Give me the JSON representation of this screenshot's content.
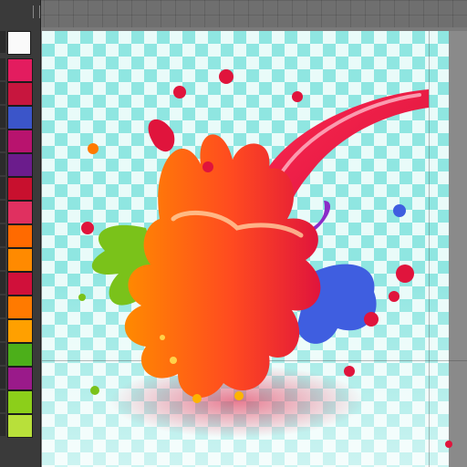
{
  "palette": {
    "swatches": [
      {
        "name": "white",
        "color": "#fafafa"
      },
      {
        "name": "pink",
        "color": "#e31c5f"
      },
      {
        "name": "crimson",
        "color": "#c7163e"
      },
      {
        "name": "blue",
        "color": "#3b55c9"
      },
      {
        "name": "magenta",
        "color": "#b8136e"
      },
      {
        "name": "purple",
        "color": "#6b1c8c"
      },
      {
        "name": "red",
        "color": "#c8102e"
      },
      {
        "name": "rose",
        "color": "#e03060"
      },
      {
        "name": "orange",
        "color": "#ff6a00"
      },
      {
        "name": "amber",
        "color": "#ff8a00"
      },
      {
        "name": "deep-red",
        "color": "#d0103a"
      },
      {
        "name": "orange-2",
        "color": "#ff7a00"
      },
      {
        "name": "yellow-orange",
        "color": "#ffa000"
      },
      {
        "name": "green",
        "color": "#4caf1a"
      },
      {
        "name": "violet",
        "color": "#9a1a8a"
      },
      {
        "name": "lime",
        "color": "#8ccf1a"
      },
      {
        "name": "light-lime",
        "color": "#b8e03a"
      }
    ]
  },
  "artwork": {
    "subject": "paint-splash",
    "colors": {
      "stream_red": "#e0143c",
      "splash_red": "#f0203c",
      "splash_orange": "#ff7a00",
      "splash_yellow": "#ffb300",
      "accent_green": "#7ac21a",
      "accent_blue": "#3f5ee0",
      "accent_purple": "#8a2cc8",
      "checker_light": "#e9fbf9",
      "checker_dark": "#8fe6e1"
    }
  }
}
